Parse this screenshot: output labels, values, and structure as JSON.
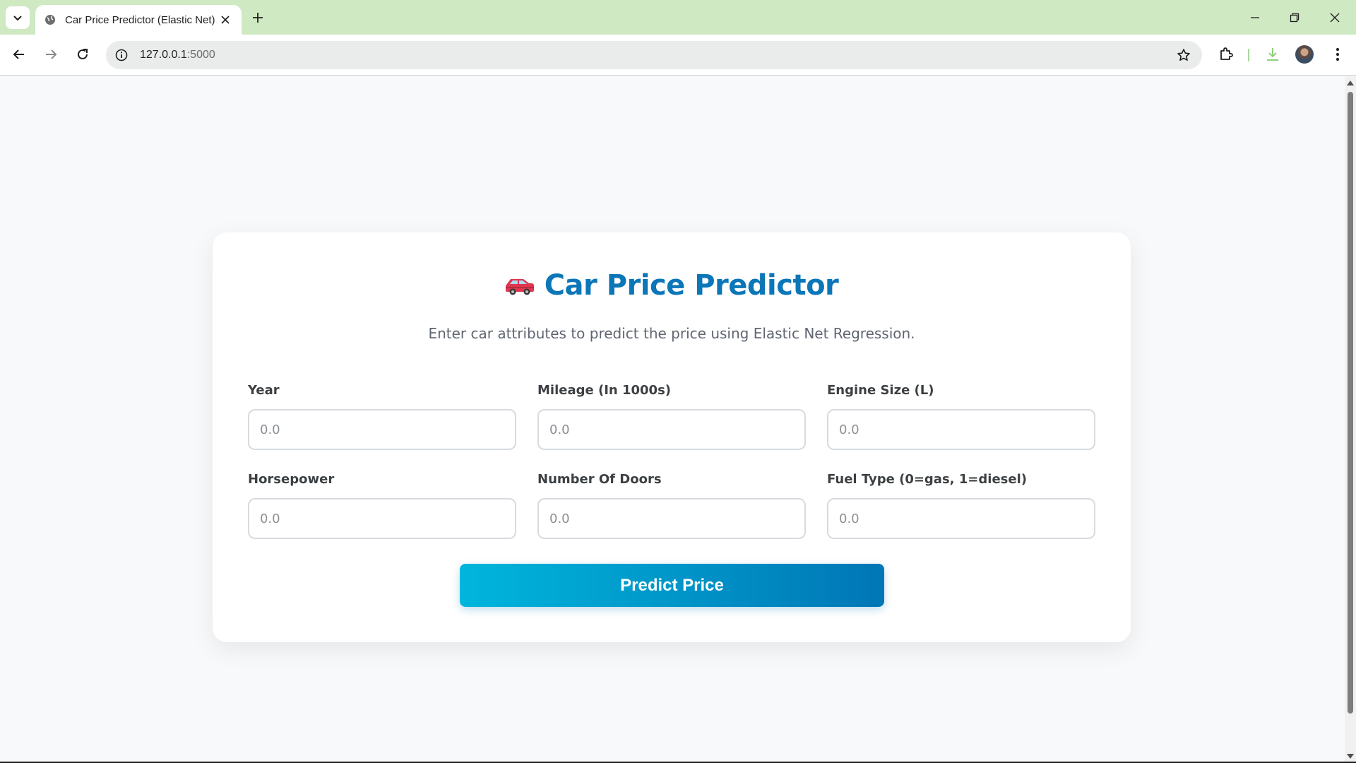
{
  "browser": {
    "tab_title": "Car Price Predictor (Elastic Net)",
    "url_host": "127.0.0.1",
    "url_port": ":5000",
    "icons": [
      "tab-search-icon",
      "globe-icon",
      "close-icon",
      "plus-icon",
      "minimize-icon",
      "restore-icon",
      "close-window-icon",
      "back-arrow-icon",
      "forward-arrow-icon",
      "reload-icon",
      "info-icon",
      "star-icon",
      "extensions-icon",
      "download-icon",
      "kebab-menu-icon"
    ]
  },
  "page": {
    "title": "Car Price Predictor",
    "title_icon": "car-icon",
    "subtitle": "Enter car attributes to predict the price using Elastic Net Regression.",
    "fields": [
      {
        "label": "Year",
        "placeholder": "0.0"
      },
      {
        "label": "Mileage (In 1000s)",
        "placeholder": "0.0"
      },
      {
        "label": "Engine Size (L)",
        "placeholder": "0.0"
      },
      {
        "label": "Horsepower",
        "placeholder": "0.0"
      },
      {
        "label": "Number Of Doors",
        "placeholder": "0.0"
      },
      {
        "label": "Fuel Type (0=gas, 1=diesel)",
        "placeholder": "0.0"
      }
    ],
    "submit_label": "Predict Price"
  },
  "colors": {
    "tabbar_bg": "#cfe9c3",
    "title_color": "#0b76b8",
    "button_gradient_start": "#00b6dc",
    "button_gradient_end": "#0076b6",
    "page_bg": "#f8f9fa"
  }
}
